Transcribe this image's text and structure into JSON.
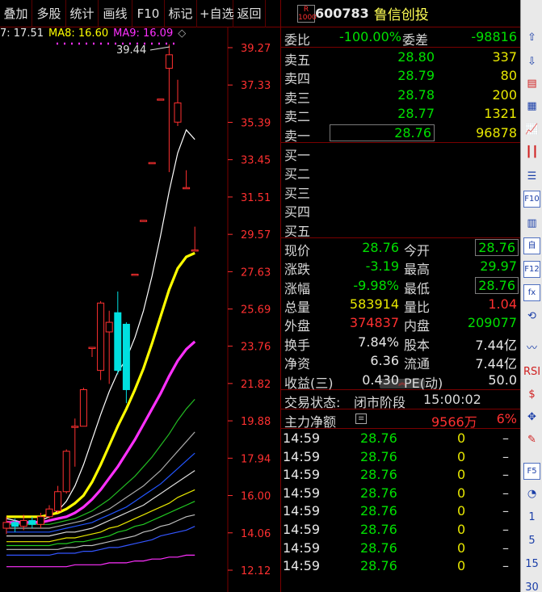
{
  "toolbar": [
    "叠加",
    "多股",
    "统计",
    "画线",
    "F10",
    "标记",
    "+自选",
    "返回"
  ],
  "ma_legend": [
    {
      "text": "7: 17.51",
      "color": "#e8e8e8"
    },
    {
      "text": "MA8: 16.60",
      "color": "#ffff00"
    },
    {
      "text": "MA9: 16.09",
      "color": "#ff30ff"
    }
  ],
  "price_axis": [
    "39.27",
    "37.33",
    "35.39",
    "33.45",
    "31.51",
    "29.57",
    "27.63",
    "25.69",
    "23.76",
    "21.82",
    "19.88",
    "17.94",
    "16.00",
    "14.06",
    "12.12"
  ],
  "high_marker": "39.44",
  "stock": {
    "badge": "R\n1000",
    "code": "600783",
    "name": "鲁信创投"
  },
  "weibi": {
    "label": "委比",
    "value": "-100.00%",
    "diff_label": "委差",
    "diff": "-98816"
  },
  "asks": [
    {
      "label": "卖五",
      "price": "28.80",
      "vol": "337"
    },
    {
      "label": "卖四",
      "price": "28.79",
      "vol": "80"
    },
    {
      "label": "卖三",
      "price": "28.78",
      "vol": "200"
    },
    {
      "label": "卖二",
      "price": "28.77",
      "vol": "1321"
    },
    {
      "label": "卖一",
      "price": "28.76",
      "vol": "96878"
    }
  ],
  "bids": [
    "买一",
    "买二",
    "买三",
    "买四",
    "买五"
  ],
  "stats": [
    {
      "l1": "现价",
      "v1": "28.76",
      "c1": "grn",
      "l2": "今开",
      "v2": "28.76",
      "c2": "grn",
      "b2": true
    },
    {
      "l1": "涨跌",
      "v1": "-3.19",
      "c1": "grn",
      "l2": "最高",
      "v2": "29.97",
      "c2": "grn",
      "b2": false
    },
    {
      "l1": "涨幅",
      "v1": "-9.98%",
      "c1": "grn",
      "l2": "最低",
      "v2": "28.76",
      "c2": "grn",
      "b2": true
    },
    {
      "l1": "总量",
      "v1": "583914",
      "c1": "yel",
      "l2": "量比",
      "v2": "1.04",
      "c2": "red",
      "b2": false
    },
    {
      "l1": "外盘",
      "v1": "374837",
      "c1": "red",
      "l2": "内盘",
      "v2": "209077",
      "c2": "grn",
      "b2": false
    },
    {
      "l1": "换手",
      "v1": "7.84%",
      "c1": "wht",
      "l2": "股本",
      "v2": "7.44亿",
      "c2": "wht",
      "b2": false
    },
    {
      "l1": "净资",
      "v1": "6.36",
      "c1": "wht",
      "l2": "流通",
      "v2": "7.44亿",
      "c2": "wht",
      "b2": false
    },
    {
      "l1": "收益(三)",
      "v1": "0.430",
      "c1": "wht",
      "l2": "PE(动)",
      "v2": "50.0",
      "c2": "wht",
      "b2": false
    }
  ],
  "trade_status": {
    "label": "交易状态:",
    "value": "闭市阶段",
    "time": "15:00:02"
  },
  "main_flow": {
    "label": "主力净额",
    "value": "9566万",
    "pct": "6%"
  },
  "ticks": [
    {
      "t": "14:59",
      "p": "28.76",
      "v": "0",
      "d": "–"
    },
    {
      "t": "14:59",
      "p": "28.76",
      "v": "0",
      "d": "–"
    },
    {
      "t": "14:59",
      "p": "28.76",
      "v": "0",
      "d": "–"
    },
    {
      "t": "14:59",
      "p": "28.76",
      "v": "0",
      "d": "–"
    },
    {
      "t": "14:59",
      "p": "28.76",
      "v": "0",
      "d": "–"
    },
    {
      "t": "14:59",
      "p": "28.76",
      "v": "0",
      "d": "–"
    },
    {
      "t": "14:59",
      "p": "28.76",
      "v": "0",
      "d": "–"
    },
    {
      "t": "14:59",
      "p": "28.76",
      "v": "0",
      "d": "–"
    }
  ],
  "side_numbers": [
    "1",
    "5",
    "15",
    "30"
  ],
  "colors": {
    "up": "#ff3030",
    "down": "#00e0e0",
    "ma1": "#ffffff",
    "ma2": "#ffff00",
    "ma3": "#ff30ff",
    "border": "#7a0000"
  },
  "chart_data": {
    "type": "candlestick",
    "y_axis_range": [
      12.12,
      39.27
    ],
    "candles": [
      {
        "o": 14.3,
        "c": 14.6,
        "h": 14.9,
        "l": 14.0
      },
      {
        "o": 14.6,
        "c": 14.4,
        "h": 14.8,
        "l": 14.1
      },
      {
        "o": 14.4,
        "c": 14.7,
        "h": 15.0,
        "l": 14.2
      },
      {
        "o": 14.7,
        "c": 14.5,
        "h": 14.9,
        "l": 14.3
      },
      {
        "o": 14.5,
        "c": 14.9,
        "h": 15.1,
        "l": 14.3
      },
      {
        "o": 14.9,
        "c": 15.3,
        "h": 15.5,
        "l": 14.8
      },
      {
        "o": 15.2,
        "c": 16.2,
        "h": 16.5,
        "l": 15.1
      },
      {
        "o": 16.2,
        "c": 18.3,
        "h": 18.4,
        "l": 16.1
      },
      {
        "o": 19.6,
        "c": 19.6,
        "h": 20.0,
        "l": 17.5
      },
      {
        "o": 19.6,
        "c": 21.5,
        "h": 21.6,
        "l": 19.6
      },
      {
        "o": 23.7,
        "c": 23.7,
        "h": 23.7,
        "l": 23.2
      },
      {
        "o": 22.5,
        "c": 26.0,
        "h": 26.1,
        "l": 22.0
      },
      {
        "o": 24.5,
        "c": 25.0,
        "h": 25.6,
        "l": 21.8
      },
      {
        "o": 25.5,
        "c": 22.5,
        "h": 26.6,
        "l": 22.3
      },
      {
        "o": 24.9,
        "c": 21.5,
        "h": 25.0,
        "l": 20.8
      },
      {
        "o": 27.5,
        "c": 27.5,
        "h": 27.5,
        "l": 27.5
      },
      {
        "o": 30.3,
        "c": 30.3,
        "h": 30.3,
        "l": 30.3
      },
      {
        "o": 33.3,
        "c": 33.3,
        "h": 33.3,
        "l": 33.3
      },
      {
        "o": 36.6,
        "c": 36.6,
        "h": 36.6,
        "l": 36.6
      },
      {
        "o": 38.2,
        "c": 38.9,
        "h": 39.44,
        "l": 32.8
      },
      {
        "o": 35.4,
        "c": 36.4,
        "h": 37.6,
        "l": 35.2
      },
      {
        "o": 32.0,
        "c": 32.0,
        "h": 32.9,
        "l": 32.0
      },
      {
        "o": 28.76,
        "c": 28.76,
        "h": 29.97,
        "l": 28.76
      }
    ],
    "ma_lines": [
      {
        "color": "#ffffff",
        "values": [
          14.8,
          14.7,
          14.6,
          14.6,
          14.7,
          14.9,
          15.2,
          15.7,
          16.5,
          17.6,
          18.9,
          20.2,
          21.4,
          22.4,
          23.1,
          24.2,
          25.6,
          27.4,
          29.5,
          31.8,
          33.8,
          35.0,
          34.5
        ]
      },
      {
        "color": "#ffff00",
        "values": [
          14.9,
          14.9,
          14.9,
          14.9,
          14.9,
          15.0,
          15.1,
          15.3,
          15.6,
          16.0,
          16.7,
          17.6,
          18.6,
          19.6,
          20.5,
          21.5,
          22.6,
          23.9,
          25.3,
          26.7,
          27.8,
          28.4,
          28.6
        ]
      },
      {
        "color": "#ff30ff",
        "values": [
          14.6,
          14.6,
          14.6,
          14.6,
          14.6,
          14.7,
          14.8,
          14.9,
          15.1,
          15.4,
          15.8,
          16.3,
          16.9,
          17.5,
          18.2,
          18.9,
          19.7,
          20.5,
          21.3,
          22.2,
          23.0,
          23.6,
          24.0
        ]
      },
      {
        "color": "#22bb22",
        "values": [
          14.5,
          14.5,
          14.5,
          14.5,
          14.5,
          14.5,
          14.6,
          14.7,
          14.8,
          15.0,
          15.2,
          15.5,
          15.8,
          16.2,
          16.6,
          17.0,
          17.5,
          18.0,
          18.6,
          19.2,
          19.9,
          20.5,
          21.0
        ]
      },
      {
        "color": "#aaaaaa",
        "values": [
          14.3,
          14.3,
          14.3,
          14.3,
          14.3,
          14.3,
          14.4,
          14.5,
          14.6,
          14.7,
          14.9,
          15.1,
          15.3,
          15.6,
          15.9,
          16.2,
          16.5,
          16.9,
          17.3,
          17.8,
          18.3,
          18.8,
          19.3
        ]
      },
      {
        "color": "#2255ff",
        "values": [
          14.1,
          14.1,
          14.1,
          14.1,
          14.1,
          14.1,
          14.2,
          14.3,
          14.4,
          14.5,
          14.6,
          14.8,
          15.0,
          15.2,
          15.4,
          15.7,
          16.0,
          16.3,
          16.6,
          17.0,
          17.4,
          17.8,
          18.2
        ]
      },
      {
        "color": "#dddddd",
        "values": [
          13.9,
          13.9,
          13.9,
          13.9,
          13.9,
          13.9,
          14.0,
          14.1,
          14.1,
          14.2,
          14.3,
          14.5,
          14.7,
          14.9,
          15.1,
          15.3,
          15.5,
          15.8,
          16.1,
          16.4,
          16.7,
          17.0,
          17.3
        ]
      },
      {
        "color": "#e8e800",
        "values": [
          13.6,
          13.6,
          13.6,
          13.6,
          13.6,
          13.6,
          13.7,
          13.8,
          13.8,
          13.9,
          14.0,
          14.1,
          14.3,
          14.4,
          14.6,
          14.8,
          15.0,
          15.2,
          15.4,
          15.6,
          15.9,
          16.1,
          16.3
        ]
      },
      {
        "color": "#22cc22",
        "values": [
          13.4,
          13.4,
          13.4,
          13.4,
          13.4,
          13.4,
          13.5,
          13.5,
          13.6,
          13.6,
          13.7,
          13.8,
          13.9,
          14.1,
          14.2,
          14.4,
          14.5,
          14.7,
          14.9,
          15.1,
          15.3,
          15.5,
          15.7
        ]
      },
      {
        "color": "#c0c0c0",
        "values": [
          13.2,
          13.2,
          13.2,
          13.2,
          13.2,
          13.2,
          13.2,
          13.3,
          13.3,
          13.4,
          13.4,
          13.5,
          13.6,
          13.7,
          13.8,
          13.9,
          14.1,
          14.2,
          14.4,
          14.5,
          14.7,
          14.9,
          15.0
        ]
      },
      {
        "color": "#3355ff",
        "values": [
          12.9,
          12.9,
          12.9,
          12.9,
          12.9,
          12.9,
          13.0,
          13.0,
          13.0,
          13.1,
          13.1,
          13.2,
          13.3,
          13.3,
          13.4,
          13.5,
          13.6,
          13.7,
          13.9,
          14.0,
          14.1,
          14.2,
          14.4
        ]
      },
      {
        "color": "#ff30ff",
        "values": [
          12.3,
          12.3,
          12.3,
          12.3,
          12.3,
          12.3,
          12.3,
          12.3,
          12.4,
          12.4,
          12.4,
          12.4,
          12.5,
          12.5,
          12.5,
          12.6,
          12.6,
          12.7,
          12.7,
          12.8,
          12.8,
          12.9,
          12.9
        ]
      }
    ]
  }
}
